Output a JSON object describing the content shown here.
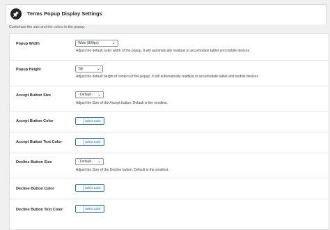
{
  "header": {
    "title": "Terms Popup Display Settings",
    "icon": "pin-icon"
  },
  "subtitle": "Customize the size and the colors in the popup.",
  "rows": [
    {
      "label": "Popup Width",
      "type": "select",
      "value": "Wide (800px)",
      "desc": "Adjust the default outer width of the popup. It will automatically readjust to accomodate tablet and mobile devices"
    },
    {
      "label": "Popup Height",
      "type": "select",
      "value": "Tall",
      "desc": "Adjust the default height of content of the popup. It will automatically readjust to accomodate tablet and mobile devices"
    },
    {
      "label": "Accept Button Size",
      "type": "select",
      "value": "- Default -",
      "desc": "Adjust the Size of the Accept button. Default is the smallest."
    },
    {
      "label": "Accept Button Color",
      "type": "color",
      "value": "Select Color"
    },
    {
      "label": "Accept Button Text Color",
      "type": "color",
      "value": "Select Color"
    },
    {
      "label": "Decline Button Size",
      "type": "select",
      "value": "- Default -",
      "desc": "Adjust the Size of the Decline button. Default is the smallest."
    },
    {
      "label": "Decline Button Color",
      "type": "color",
      "value": "Select Color"
    },
    {
      "label": "Decline Button Text Color",
      "type": "color",
      "value": "Select Color"
    }
  ]
}
